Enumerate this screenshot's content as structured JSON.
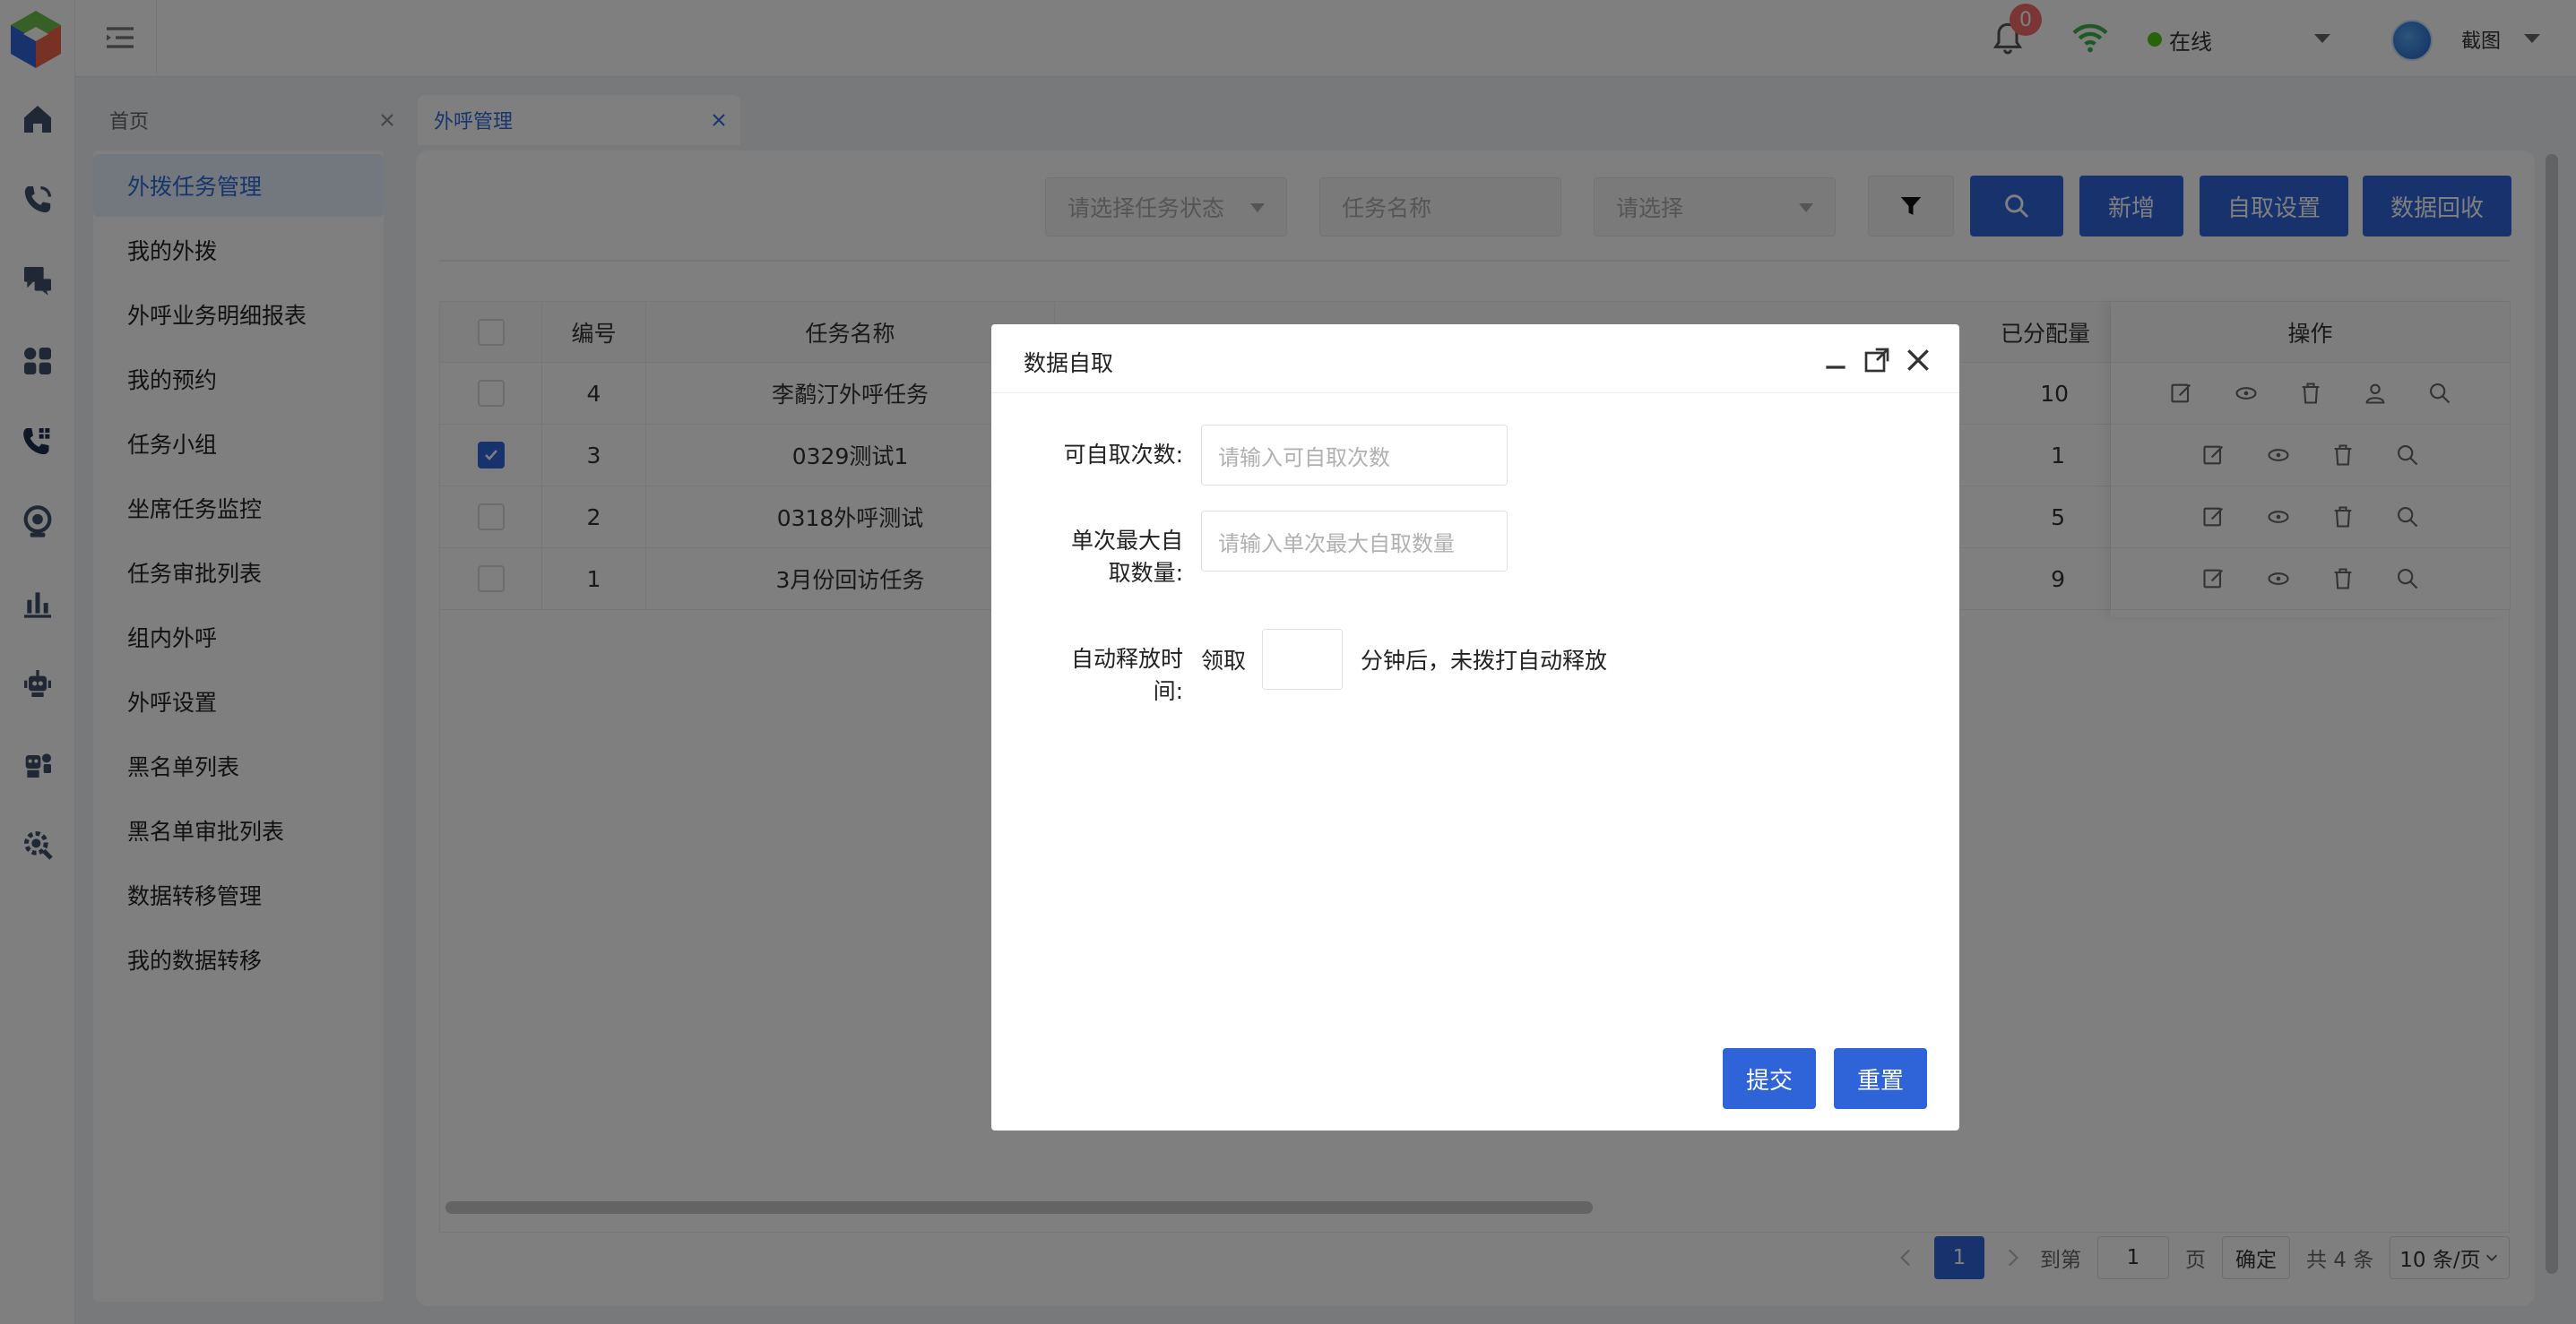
{
  "header": {
    "notification_count": "0",
    "status_label": "在线",
    "status_color": "#52c41a",
    "user_name": "截图"
  },
  "rail": {
    "icons": [
      "app-logo",
      "home-icon",
      "phone-call-icon",
      "chat-icon",
      "apps-icon",
      "outbound-call-icon",
      "webcam-icon",
      "bar-chart-icon",
      "robot-icon",
      "robot-agent-icon",
      "settings-gear-icon"
    ]
  },
  "tabs": [
    {
      "label": "首页"
    },
    {
      "label": "外呼管理"
    }
  ],
  "menu": {
    "items": [
      {
        "label": "外拨任务管理"
      },
      {
        "label": "我的外拨"
      },
      {
        "label": "外呼业务明细报表"
      },
      {
        "label": "我的预约"
      },
      {
        "label": "任务小组"
      },
      {
        "label": "坐席任务监控"
      },
      {
        "label": "任务审批列表"
      },
      {
        "label": "组内外呼"
      },
      {
        "label": "外呼设置"
      },
      {
        "label": "黑名单列表"
      },
      {
        "label": "黑名单审批列表"
      },
      {
        "label": "数据转移管理"
      },
      {
        "label": "我的数据转移"
      }
    ]
  },
  "toolbar": {
    "task_status_placeholder": "请选择任务状态",
    "task_name_placeholder": "任务名称",
    "select_placeholder": "请选择",
    "add_label": "新增",
    "self_fetch_settings_label": "自取设置",
    "data_recycle_label": "数据回收"
  },
  "table": {
    "columns": {
      "id": "编号",
      "task_name": "任务名称",
      "allocated": "已分配量",
      "operations": "操作"
    },
    "rows": [
      {
        "id": "4",
        "task_name": "李鹬汀外呼任务",
        "allocated": "10",
        "checked": false
      },
      {
        "id": "3",
        "task_name": "0329测试1",
        "allocated": "1",
        "checked": true
      },
      {
        "id": "2",
        "task_name": "0318外呼测试",
        "allocated": "5",
        "checked": false
      },
      {
        "id": "1",
        "task_name": "3月份回访任务",
        "allocated": "9",
        "checked": false
      }
    ]
  },
  "pagination": {
    "current_page": "1",
    "goto_label": "到第",
    "goto_value": "1",
    "page_unit": "页",
    "confirm_label": "确定",
    "total_label": "共 4 条",
    "page_size_label": "10 条/页"
  },
  "modal": {
    "title": "数据自取",
    "fetch_times_label": "可自取次数:",
    "fetch_times_placeholder": "请输入可自取次数",
    "max_fetch_label_line1": "单次最大自",
    "max_fetch_label_line2": "取数量:",
    "max_fetch_placeholder": "请输入单次最大自取数量",
    "release_label_line1": "自动释放时",
    "release_label_line2": "间:",
    "release_prefix": "领取",
    "release_minutes_value": "",
    "release_suffix": "分钟后，未拨打自动释放",
    "submit_label": "提交",
    "reset_label": "重置"
  },
  "colors": {
    "primary": "#2f64d8",
    "badge": "#f56c6c",
    "active_menu_bg": "#e6eefc"
  }
}
